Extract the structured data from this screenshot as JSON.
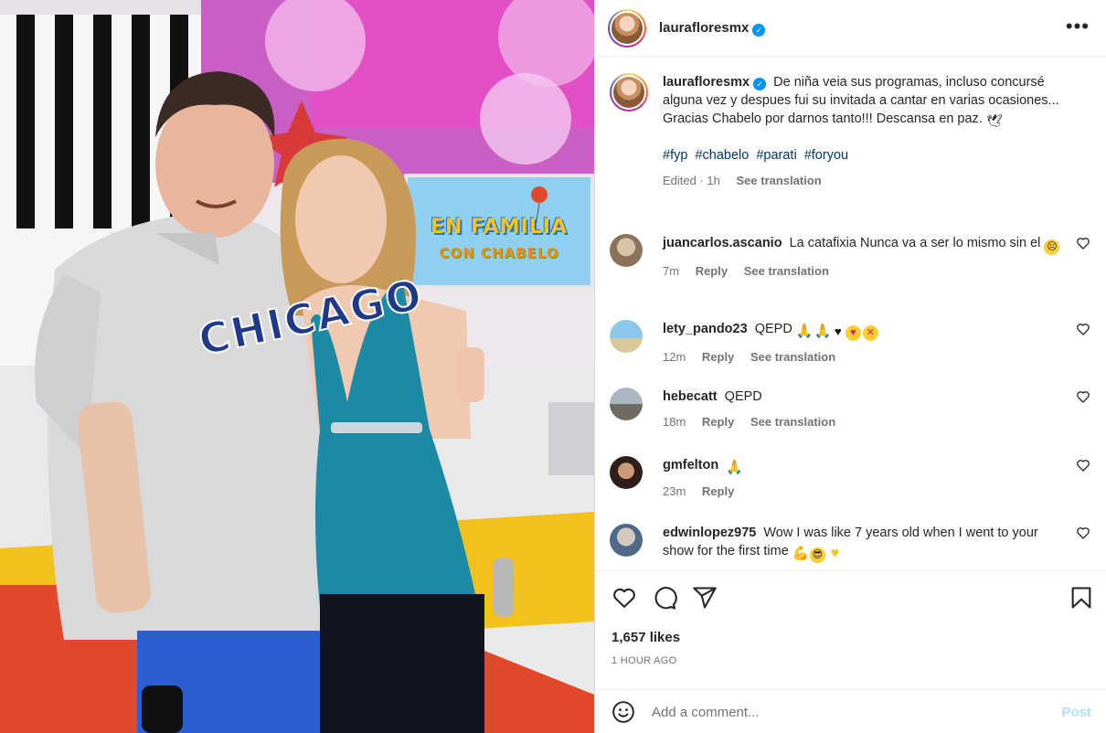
{
  "post": {
    "username": "laurafloresmx",
    "verified": true,
    "caption": "De niña veia sus programas, incluso concursé alguna vez y despues fui su invitada a cantar en varias ocasiones... Gracias Chabelo por darnos tanto!!! Descansa en paz.",
    "caption_emoji": "dove",
    "hashtags": [
      "#fyp",
      "#chabelo",
      "#parati",
      "#foryou"
    ],
    "edited": "Edited · 1h",
    "see_translation": "See translation",
    "likes": "1,657 likes",
    "time": "1 HOUR AGO"
  },
  "photo": {
    "sign_line1": "EN FAMILIA",
    "sign_line2": "CON CHABELO",
    "jersey_text": "CHICAGO"
  },
  "comments": [
    {
      "user": "juancarlos.ascanio",
      "text": "La catafixia Nunca va a ser lo mismo sin el",
      "emojis": [
        "disappointed-face"
      ],
      "time": "7m",
      "reply": "Reply",
      "translate": "See translation"
    },
    {
      "user": "lety_pando23",
      "text": "QEPD",
      "emojis": [
        "folded-hands",
        "folded-hands",
        "black-heart",
        "heart-eyes-face",
        "kissing-face"
      ],
      "time": "12m",
      "reply": "Reply",
      "translate": "See translation"
    },
    {
      "user": "hebecatt",
      "text": "QEPD",
      "emojis": [],
      "time": "18m",
      "reply": "Reply",
      "translate": "See translation"
    },
    {
      "user": "gmfelton",
      "text": "",
      "emojis": [
        "folded-hands"
      ],
      "time": "23m",
      "reply": "Reply",
      "translate": ""
    },
    {
      "user": "edwinlopez975",
      "text": "Wow I was like 7 years old when I went to your show for the first time",
      "emojis": [
        "flexed-biceps",
        "sunglasses-face",
        "yellow-heart"
      ],
      "time": "",
      "reply": "",
      "translate": ""
    }
  ],
  "composer": {
    "placeholder": "Add a comment...",
    "post_label": "Post"
  },
  "icons": {
    "more": "more-options-icon",
    "like": "heart-icon",
    "comment": "comment-icon",
    "share": "share-icon",
    "save": "bookmark-icon",
    "emoji": "emoji-icon"
  },
  "colors": {
    "accent": "#0095f6",
    "link": "#00376b",
    "muted": "#737373",
    "post_disabled": "#b2dffc"
  }
}
